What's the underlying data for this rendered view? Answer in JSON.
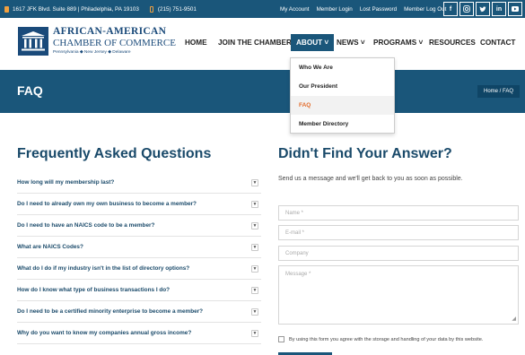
{
  "topbar": {
    "address": "1617 JFK Blvd. Suite 889 | Philadelphia, PA 19103",
    "phone": "(215) 751-9501",
    "links": [
      "My Account",
      "Member Login",
      "Lost Password",
      "Member Log Out"
    ],
    "social": [
      "f",
      "ig",
      "tw",
      "in",
      "yt"
    ]
  },
  "logo": {
    "line1": "AFRICAN-AMERICAN",
    "line2": "CHAMBER OF COMMERCE",
    "line3": "Pennsylvania ◆ New Jersey ◆ Delaware"
  },
  "nav": {
    "home": "HOME",
    "join": "JOIN THE CHAMBER",
    "about": "ABOUT",
    "news": "NEWS",
    "programs": "PROGRAMS",
    "resources": "RESOURCES",
    "contact": "CONTACT"
  },
  "about_menu": [
    "Who We Are",
    "Our President",
    "FAQ",
    "Member Directory"
  ],
  "banner": {
    "title": "FAQ",
    "breadcrumb": "Home / FAQ"
  },
  "faq": {
    "heading": "Frequently Asked Questions",
    "items": [
      "How long will my membership last?",
      "Do I need to already own my own business to become a member?",
      "Do I need to have an NAICS code to be a member?",
      "What are NAICS Codes?",
      "What do I do if my industry isn't in the list of directory options?",
      "How do I know what type of business transactions I do?",
      "Do I need to be a certified minority enterprise to become a member?",
      "Why do you want to know my companies annual gross income?"
    ]
  },
  "contact": {
    "heading": "Didn't Find Your Answer?",
    "subtitle": "Send us a message and we'll get back to you as soon as possible.",
    "name_ph": "Name *",
    "email_ph": "E-mail *",
    "company_ph": "Company",
    "message_ph": "Message *",
    "consent": "By using this form you agree with the storage and handling of your data by this website."
  }
}
